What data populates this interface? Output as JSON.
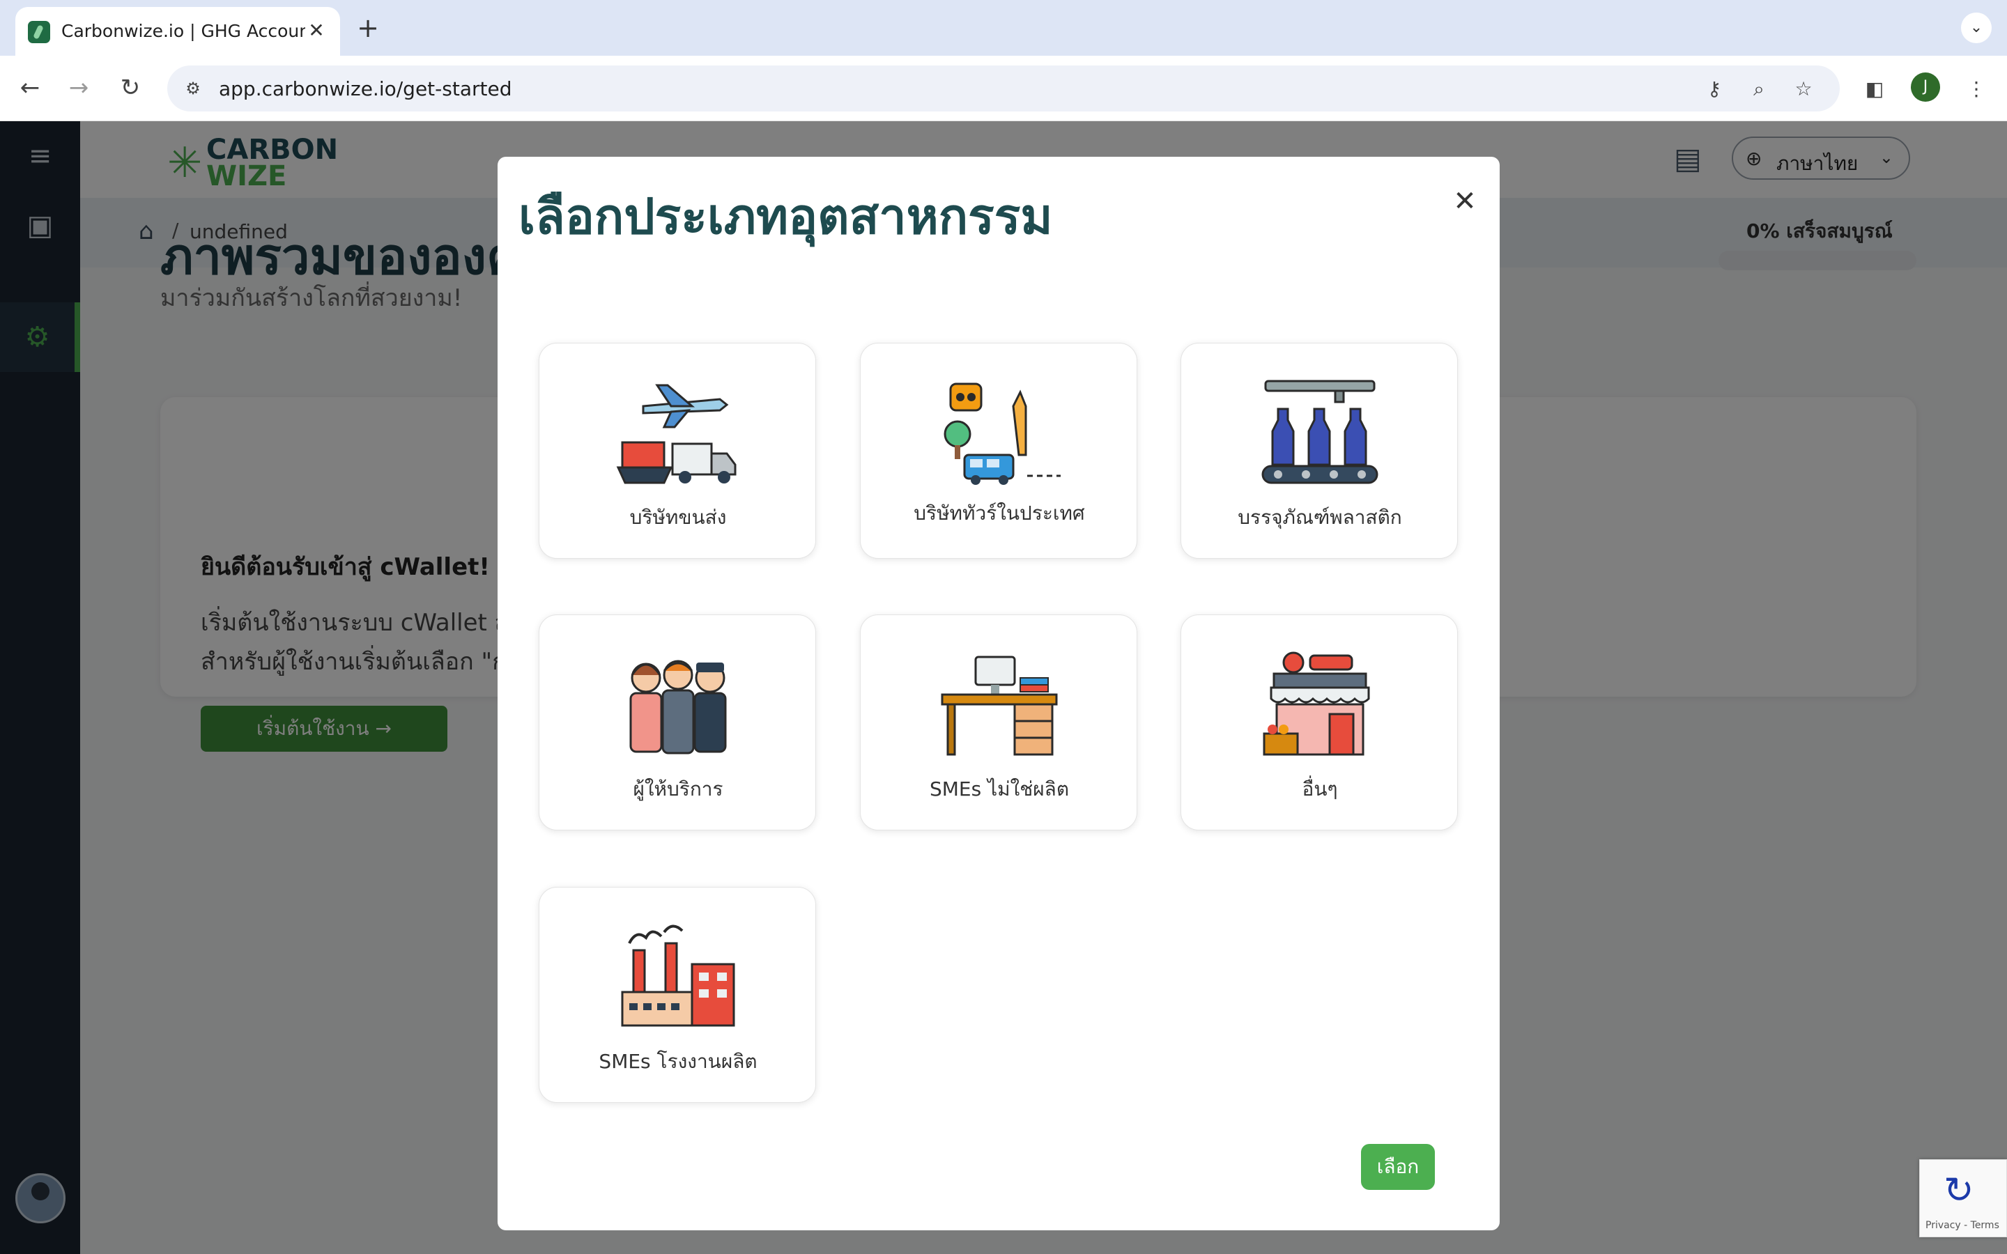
{
  "browser": {
    "tab_title": "Carbonwize.io | GHG Accoun",
    "tab_close": "✕",
    "new_tab": "+",
    "tab_menu": "⌄",
    "url": "app.carbonwize.io/get-started",
    "profile_initial": "J"
  },
  "app": {
    "logo_line1": "CARBON",
    "logo_line2": "WIZE",
    "language": "ภาษาไทย",
    "breadcrumb_current": "undefined",
    "breadcrumb_sep": "/",
    "page_title": "ภาพรวมขององค์",
    "page_subtitle": "มาร่วมกันสร้างโลกที่สวยงาม!",
    "progress_label": "0% เสร็จสมบูรณ์",
    "progress_value": 0,
    "welcome_title": "ยินดีต้อนรับเข้าสู่ cWallet!",
    "welcome_line1": "เริ่มต้นใช้งานระบบ cWallet สำ",
    "welcome_line2": "สำหรับผู้ใช้งานเริ่มต้นเลือก \"ก",
    "start_button": "เริ่มต้นใช้งาน →",
    "recaptcha_text": "Privacy - Terms"
  },
  "modal": {
    "title": "เลือกประเภทอุตสาหกรรม",
    "close": "✕",
    "select_button": "เลือก",
    "industries": [
      {
        "label": "บริษัทขนส่ง",
        "icon": "transport-icon"
      },
      {
        "label": "บริษัททัวร์ในประเทศ",
        "icon": "tour-icon"
      },
      {
        "label": "บรรจุภัณฑ์พลาสติก",
        "icon": "bottle-conveyor-icon"
      },
      {
        "label": "ผู้ให้บริการ",
        "icon": "service-people-icon"
      },
      {
        "label": "SMEs ไม่ใช่ผลิต",
        "icon": "office-desk-icon"
      },
      {
        "label": "อื่นๆ",
        "icon": "shop-icon"
      },
      {
        "label": "SMEs โรงงานผลิต",
        "icon": "factory-icon"
      }
    ]
  },
  "colors": {
    "brand_green": "#4caf50",
    "brand_dark": "#1e4b57",
    "sidebar_bg": "#1a2530",
    "button_dark_green": "#3f8f3a"
  }
}
